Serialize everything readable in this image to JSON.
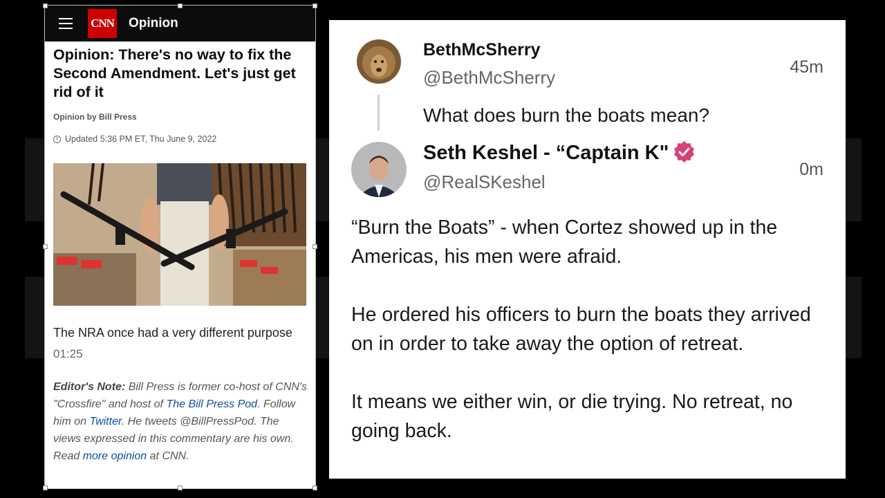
{
  "cnn": {
    "section": "Opinion",
    "logo": "CNN",
    "headline": "Opinion: There's no way to fix the Second Amendment. Let's just get rid of it",
    "byline": "Opinion by Bill Press",
    "updated": "Updated 5:36 PM ET, Thu June 9, 2022",
    "video_caption": "The NRA once had a very different purpose",
    "video_duration": "01:25",
    "note_label": "Editor's Note:",
    "note_text_1": "Bill Press is former co-host of CNN's \"Crossfire\" and host of",
    "note_link_1": "The Bill Press Pod",
    "note_text_2": ". Follow him on",
    "note_link_2": "Twitter",
    "note_text_3": ". He tweets @BillPressPod. The views expressed in this commentary are his own. Read",
    "note_link_3": "more opinion",
    "note_text_4": "at CNN."
  },
  "tweet": {
    "reply_user": {
      "name": "BethMcSherry",
      "handle": "@BethMcSherry",
      "time": "45m",
      "text": "What does burn the boats mean?"
    },
    "main_user": {
      "name": "Seth Keshel - “Captain K\"",
      "handle": "@RealSKeshel",
      "time": "0m",
      "badge_color": "#d9407a"
    },
    "paragraphs": [
      "“Burn the Boats” - when Cortez showed up in the Americas, his men were afraid.",
      "He ordered his officers to burn the boats they arrived on in order to take away the option of retreat.",
      "It means we either win, or die trying. No retreat, no going back."
    ]
  }
}
